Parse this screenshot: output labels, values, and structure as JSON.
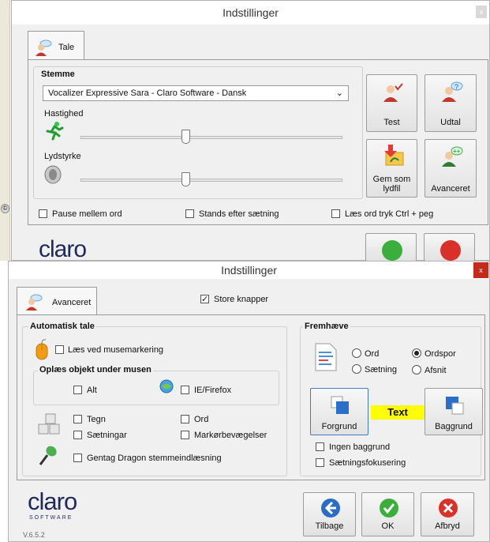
{
  "tale_window": {
    "title": "Indstillinger",
    "close_glyph": "x",
    "tab_label": "Tale",
    "voice_group_title": "Stemme",
    "voice_select_value": "Vocalizer Expressive Sara - Claro Software - Dansk",
    "speed_label": "Hastighed",
    "volume_label": "Lydstyrke",
    "speed_value": 0.4,
    "volume_value": 0.4,
    "buttons": {
      "test": "Test",
      "pronounce": "Udtal",
      "save_audio_line1": "Gem som",
      "save_audio_line2": "lydfil",
      "advanced": "Avanceret"
    },
    "checkboxes": {
      "pause": "Pause mellem ord",
      "stop": "Stands efter sætning",
      "read_ctrl": "Læs ord tryk Ctrl + peg"
    },
    "logo_text": "claro"
  },
  "adv_window": {
    "title": "Indstillinger",
    "close_glyph": "x",
    "tab_label": "Avanceret",
    "large_buttons_label": "Store knapper",
    "large_buttons_checked": true,
    "auto_speech": {
      "title": "Automatisk tale",
      "mouse_select": "Læs ved musemarkering",
      "under_mouse_title": "Oplæs objekt under musen",
      "all": "Alt",
      "ie_firefox": "IE/Firefox",
      "chars": "Tegn",
      "words": "Ord",
      "sentences": "Sætningar",
      "cursor_moves": "Markørbevægelser",
      "dragon": "Gentag Dragon stemmeindlæsning"
    },
    "highlight": {
      "title": "Fremhæve",
      "word": "Ord",
      "word_track": "Ordspor",
      "sentence": "Sætning",
      "paragraph": "Afsnit",
      "selected": "Ordspor",
      "foreground_btn": "Forgrund",
      "background_btn": "Baggrund",
      "sample_text": "Text",
      "sample_bg": "#ffff00",
      "no_background": "Ingen baggrund",
      "sentence_focus": "Sætningsfokusering"
    },
    "buttons": {
      "back": "Tilbage",
      "ok": "OK",
      "cancel": "Afbryd"
    },
    "logo_text": "claro",
    "logo_sub": "SOFTWARE",
    "version": "V.6.5.2"
  }
}
